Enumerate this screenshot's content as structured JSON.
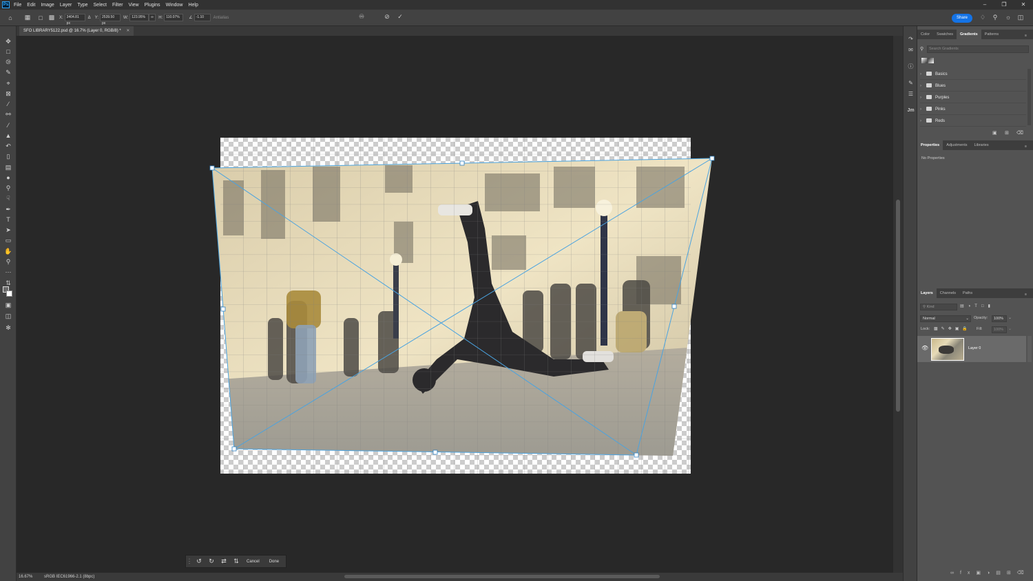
{
  "app": {
    "logo_text": "Ps"
  },
  "menu": [
    "File",
    "Edit",
    "Image",
    "Layer",
    "Type",
    "Select",
    "Filter",
    "View",
    "Plugins",
    "Window",
    "Help"
  ],
  "options": {
    "x_label": "X:",
    "x_value": "3404.81 px",
    "y_label": "Y:",
    "y_value": "2539.50 px",
    "w_label": "W:",
    "w_value": "123.95%",
    "h_label": "H:",
    "h_value": "110.07%",
    "angle_value": "-1.10",
    "interp_label": "Antialias",
    "share_label": "Share"
  },
  "document": {
    "tab_title": "SFO LIBRARY5122.psd @ 16.7% (Layer 0, RGB/8) *"
  },
  "status": {
    "zoom": "16.67%",
    "profile": "sRGB IEC61966-2.1 (8bpc)"
  },
  "floating_bar": {
    "cancel_label": "Cancel",
    "done_label": "Done"
  },
  "gradients_panel": {
    "tabs": [
      "Color",
      "Swatches",
      "Gradients",
      "Patterns"
    ],
    "active_tab": "Gradients",
    "search_placeholder": "Search Gradients",
    "folders": [
      "Basics",
      "Blues",
      "Purples",
      "Pinks",
      "Reds"
    ]
  },
  "properties_panel": {
    "tabs": [
      "Properties",
      "Adjustments",
      "Libraries"
    ],
    "active_tab": "Properties",
    "empty_text": "No Properties"
  },
  "layers_panel": {
    "tabs": [
      "Layers",
      "Channels",
      "Paths"
    ],
    "active_tab": "Layers",
    "kind_placeholder": "Kind",
    "blend_mode": "Normal",
    "opacity_label": "Opacity:",
    "opacity_value": "100%",
    "lock_label": "Lock:",
    "fill_label": "Fill:",
    "fill_value": "100%",
    "layers": [
      {
        "name": "Layer 0",
        "visible": true
      }
    ]
  },
  "icon_strip": {
    "user_initials": "Jm"
  },
  "colors": {
    "accent": "#1473e6",
    "transform_line": "#4aa3e0",
    "canvas_bg": "#282828"
  }
}
